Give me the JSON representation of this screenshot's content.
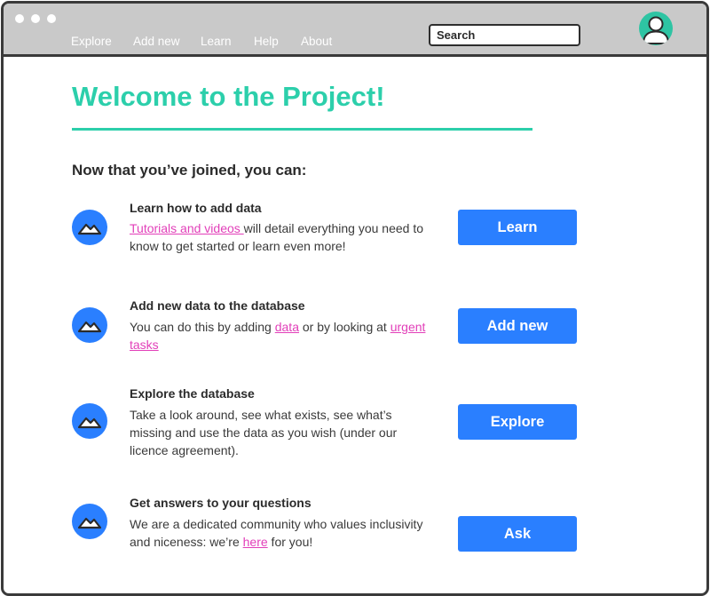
{
  "nav": {
    "items": [
      {
        "label": "Explore"
      },
      {
        "label": "Add new"
      },
      {
        "label": "Learn"
      },
      {
        "label": "Help"
      },
      {
        "label": "About"
      }
    ]
  },
  "search": {
    "placeholder": "Search"
  },
  "header": {
    "title": "Welcome to the Project!",
    "subtitle": "Now that you’ve joined, you can:"
  },
  "features": [
    {
      "icon": "mountain-icon",
      "heading": "Learn how to add data",
      "desc_link": "Tutorials and videos ",
      "desc_text": "will detail everything you need to know to get started or learn even more!",
      "button": "Learn"
    },
    {
      "icon": "mountain-icon",
      "heading": "Add new data to the database",
      "desc_pre": "You can do this by adding ",
      "desc_link1": "data",
      "desc_mid": " or by looking at ",
      "desc_link2": "urgent tasks",
      "button": "Add new"
    },
    {
      "icon": "mountain-icon",
      "heading": "Explore the database",
      "desc_text": "Take a look around, see what exists, see what’s missing and use the data as you wish (under our licence agreement).",
      "button": "Explore"
    },
    {
      "icon": "mountain-icon",
      "heading": "Get answers to your questions",
      "desc_pre": "We are a dedicated community who values inclusivity and niceness: we’re ",
      "desc_link": "here",
      "desc_post": " for you!",
      "button": "Ask"
    }
  ],
  "colors": {
    "accent_teal": "#2ccfab",
    "button_blue": "#2a7fff",
    "link_pink": "#e23fb9",
    "titlebar_gray": "#c9c9c9"
  }
}
